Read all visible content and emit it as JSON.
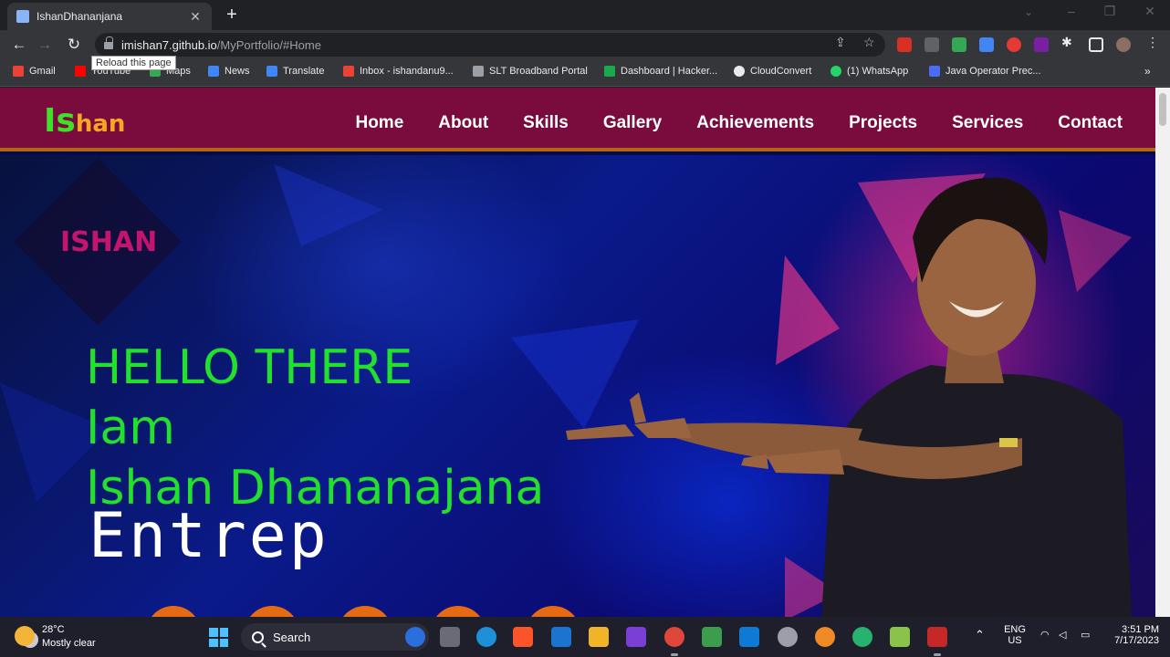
{
  "browser": {
    "tab_title": "IshanDhananjana",
    "new_tab_label": "+",
    "tab_close_label": "✕",
    "url_host": "imishan7.github.io",
    "url_path": "/MyPortfolio/#Home",
    "tooltip": "Reload this page"
  },
  "bookmarks": [
    {
      "label": "Gmail",
      "color": "#ea4335"
    },
    {
      "label": "YouTube",
      "color": "#ff0000"
    },
    {
      "label": "Maps",
      "color": "#34a853"
    },
    {
      "label": "News",
      "color": "#4285f4"
    },
    {
      "label": "Translate",
      "color": "#4285f4"
    },
    {
      "label": "Inbox - ishandanu9...",
      "color": "#ea4335"
    },
    {
      "label": "SLT Broadband Portal",
      "color": "#9aa0a6"
    },
    {
      "label": "Dashboard | Hacker...",
      "color": "#1ba94c"
    },
    {
      "label": "CloudConvert",
      "color": "#e8eaed"
    },
    {
      "label": "(1) WhatsApp",
      "color": "#25d366"
    },
    {
      "label": "Java Operator Prec...",
      "color": "#4a6cf7"
    }
  ],
  "site": {
    "logo_first": "Is",
    "logo_rest": "han",
    "menu": [
      "Home",
      "About",
      "Skills",
      "Gallery",
      "Achievements",
      "Projects",
      "Services",
      "Contact"
    ],
    "tag": "ISHAN",
    "hello_line1": "HELLO THERE",
    "hello_line2": "Iam",
    "hello_line3": "Ishan Dhananajana",
    "typed_text": "Entrep"
  },
  "taskbar": {
    "temperature": "28°C",
    "weather": "Mostly clear",
    "search_placeholder": "Search",
    "lang_top": "ENG",
    "lang_bottom": "US",
    "time": "3:51 PM",
    "date": "7/17/2023"
  },
  "colors": {
    "nav_bg": "#7a0c3d",
    "accent_green": "#22e12c",
    "accent_orange": "#f5a623",
    "tag_pink": "#c4146e"
  }
}
